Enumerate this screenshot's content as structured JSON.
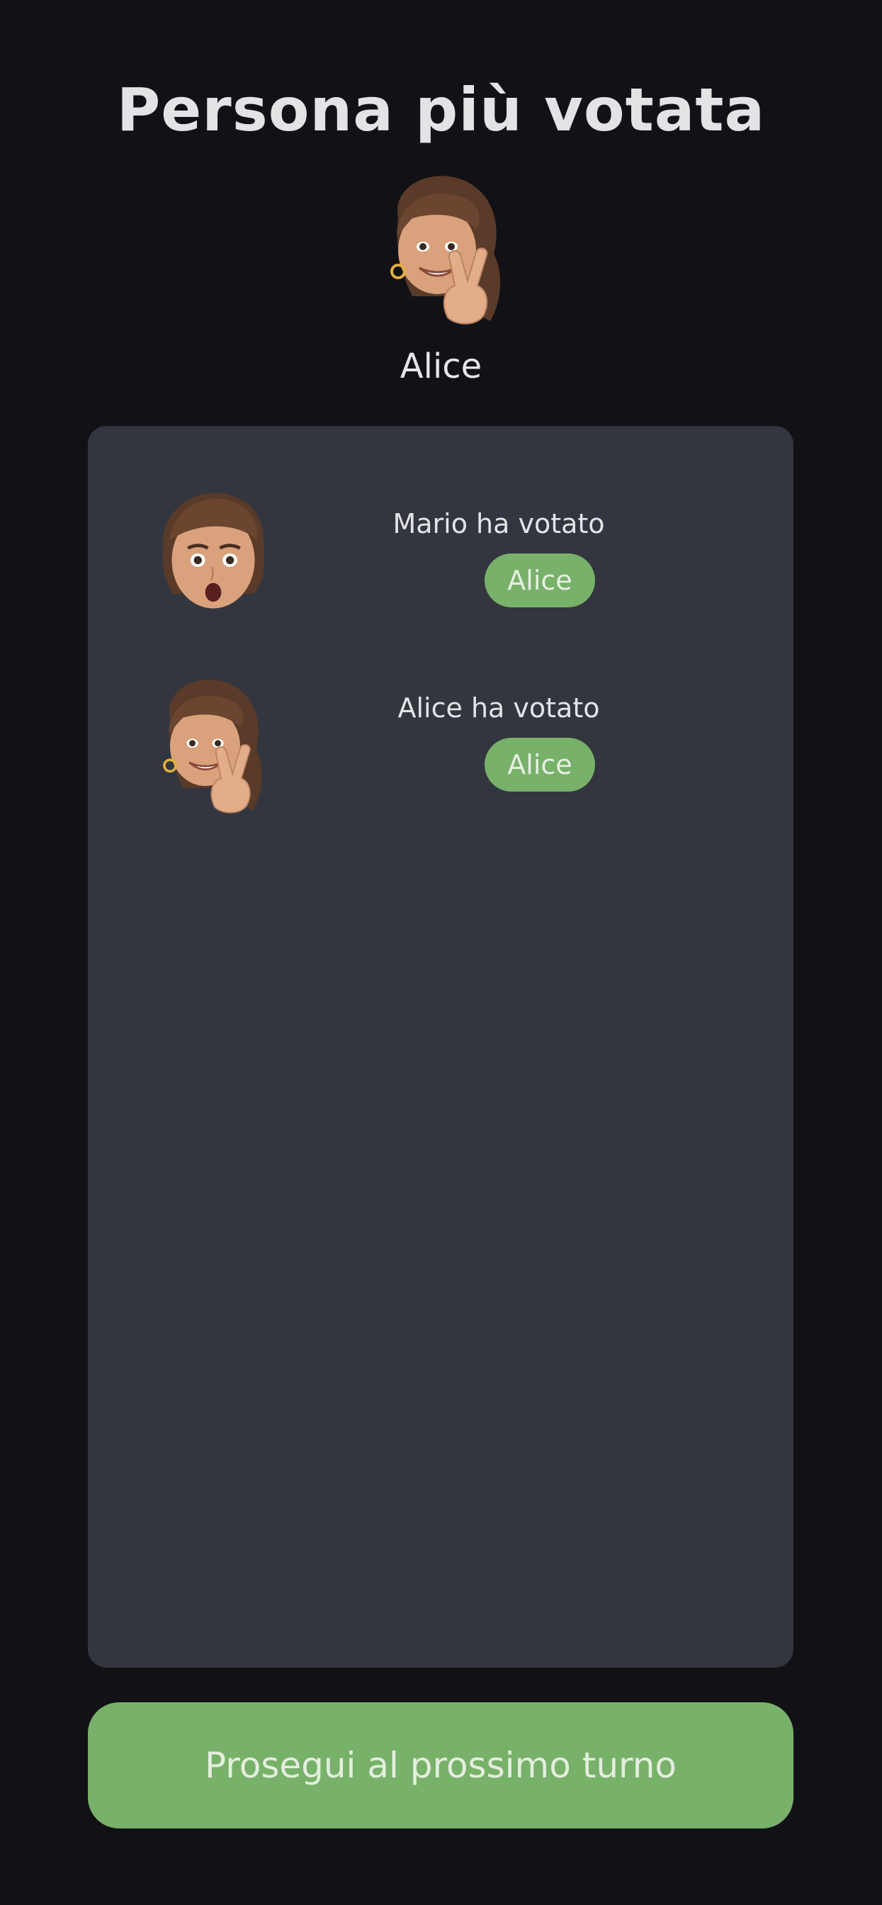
{
  "header": {
    "title": "Persona più votata"
  },
  "winner": {
    "avatar_icon": "memoji-peace-sign-icon",
    "name": "Alice"
  },
  "votes": [
    {
      "avatar_icon": "memoji-surprised-icon",
      "label": "Mario ha votato",
      "choice": "Alice"
    },
    {
      "avatar_icon": "memoji-peace-sign-icon",
      "label": "Alice ha votato",
      "choice": "Alice"
    }
  ],
  "footer": {
    "next_label": "Prosegui al prossimo turno"
  },
  "colors": {
    "background": "#121216",
    "panel": "#33363e",
    "accent": "#78b16a"
  }
}
